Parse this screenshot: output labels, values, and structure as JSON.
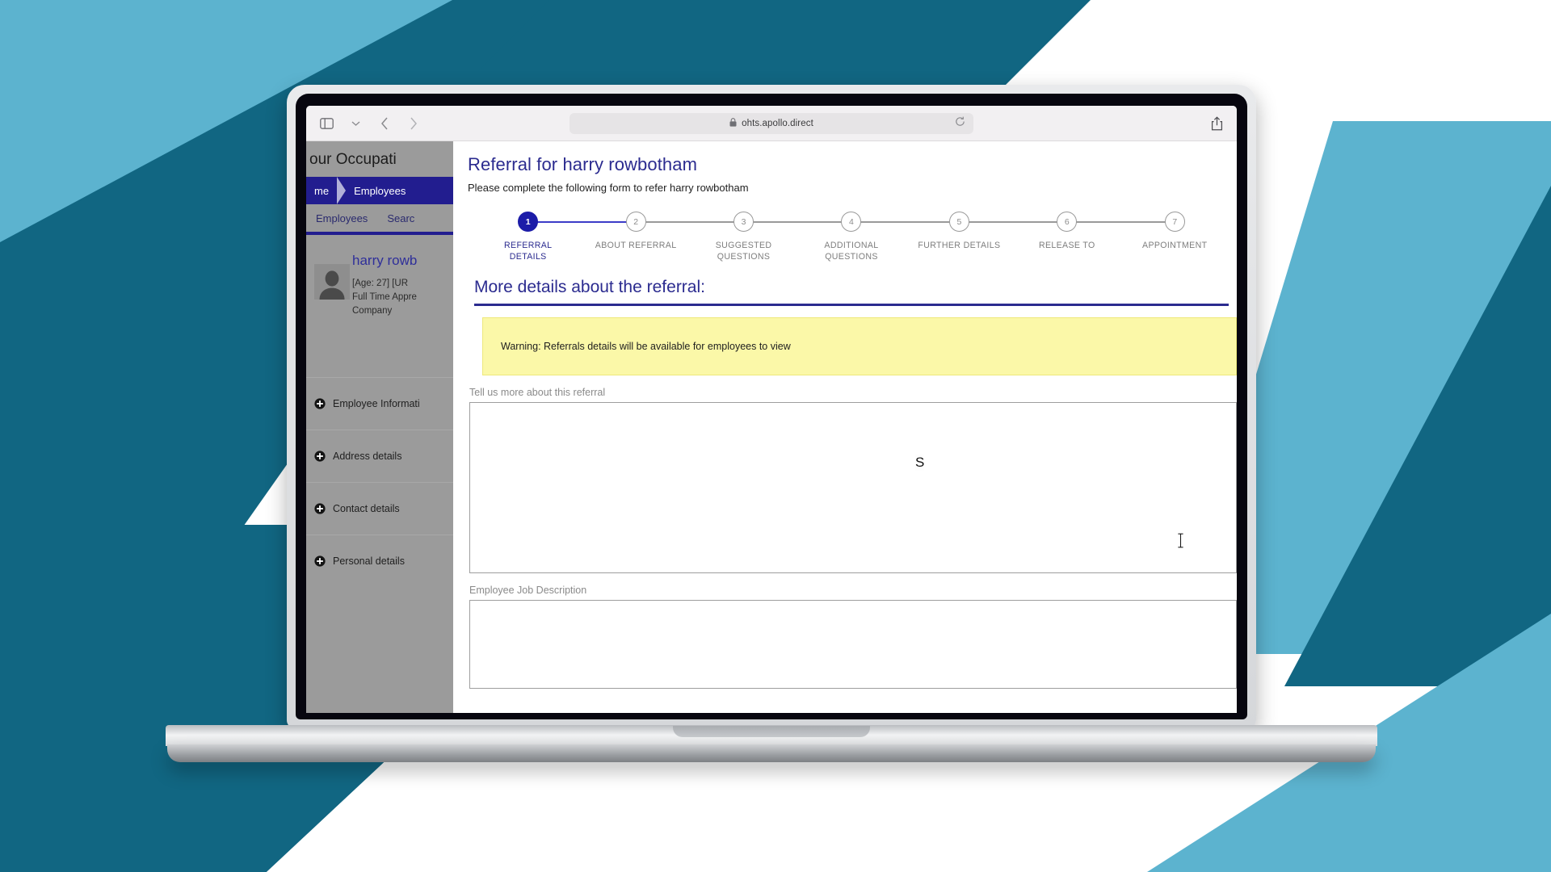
{
  "browser": {
    "url": "ohts.apollo.direct",
    "lock_icon": "lock-icon",
    "sidebar_icon": "sidebar-toggle-icon",
    "back_icon": "back-chevron-icon",
    "forward_icon": "forward-chevron-icon",
    "reload_icon": "reload-icon",
    "share_icon": "share-icon",
    "tab_dropdown_icon": "chevron-down-icon"
  },
  "app": {
    "title": "our Occupati",
    "breadcrumb": {
      "home": "me",
      "current": "Employees"
    },
    "subnav": [
      "Employees",
      "Searc"
    ],
    "employee": {
      "name": "harry rowb",
      "meta_line1": "[Age: 27] [UR",
      "meta_line2": "Full Time Appre",
      "meta_line3": "Company",
      "avatar_icon": "person-avatar-icon"
    },
    "accordions": [
      {
        "label": "Employee Informati",
        "icon": "plus-circle-icon"
      },
      {
        "label": "Address details",
        "icon": "plus-circle-icon"
      },
      {
        "label": "Contact details",
        "icon": "plus-circle-icon"
      },
      {
        "label": "Personal details",
        "icon": "plus-circle-icon"
      }
    ]
  },
  "modal": {
    "close_label": "×",
    "title": "Referral for harry rowbotham",
    "subtitle": "Please complete the following form to refer harry rowbotham",
    "steps": [
      {
        "number": "1",
        "label": "REFERRAL DETAILS",
        "active": true
      },
      {
        "number": "2",
        "label": "ABOUT REFERRAL",
        "active": false
      },
      {
        "number": "3",
        "label": "SUGGESTED QUESTIONS",
        "active": false
      },
      {
        "number": "4",
        "label": "ADDITIONAL QUESTIONS",
        "active": false
      },
      {
        "number": "5",
        "label": "FURTHER DETAILS",
        "active": false
      },
      {
        "number": "6",
        "label": "RELEASE TO",
        "active": false
      },
      {
        "number": "7",
        "label": "APPOINTMENT",
        "active": false
      }
    ],
    "section_title": "More details about the referral:",
    "warning": "Warning: Referrals details will be available for employees to view",
    "fields": [
      {
        "label": "Tell us more about this referral",
        "value": "",
        "placeholder": ""
      },
      {
        "label": "Employee Job Description",
        "value": "",
        "placeholder": ""
      }
    ],
    "floating_char": "S"
  },
  "colors": {
    "brand_blue": "#2b2b8f",
    "step_active": "#1c1ca8",
    "warning_bg": "#fbf8a8",
    "bg_light_blue": "#5cb3cf",
    "bg_dark_teal": "#116682",
    "app_grey": "#9b9b9b"
  }
}
